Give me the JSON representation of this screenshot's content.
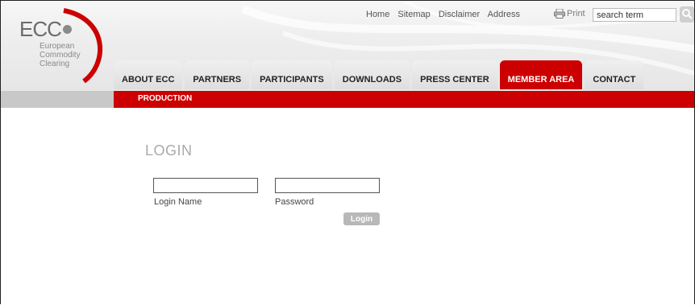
{
  "logo": {
    "name": "ECC",
    "line1": "European",
    "line2": "Commodity",
    "line3": "Clearing"
  },
  "toplinks": [
    "Home",
    "Sitemap",
    "Disclaimer",
    "Address"
  ],
  "print_label": "Print",
  "search": {
    "value": "search term"
  },
  "tabs": [
    {
      "label": "ABOUT ECC",
      "active": false
    },
    {
      "label": "PARTNERS",
      "active": false
    },
    {
      "label": "PARTICIPANTS",
      "active": false
    },
    {
      "label": "DOWNLOADS",
      "active": false
    },
    {
      "label": "PRESS CENTER",
      "active": false
    },
    {
      "label": "MEMBER AREA",
      "active": true
    },
    {
      "label": "CONTACT",
      "active": false
    }
  ],
  "subnav": {
    "label": "PRODUCTION"
  },
  "login": {
    "title": "LOGIN",
    "name_label": "Login Name",
    "name_value": "",
    "password_label": "Password",
    "password_value": "",
    "button": "Login"
  },
  "colors": {
    "accent": "#cc0000",
    "muted": "#aaaaaa"
  }
}
